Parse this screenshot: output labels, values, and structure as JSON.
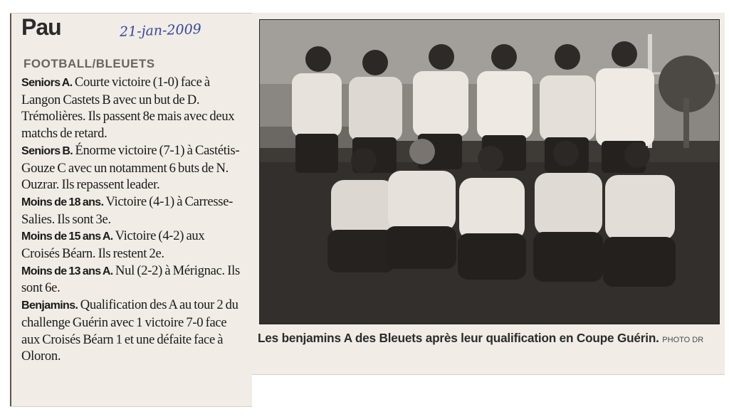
{
  "header": {
    "city": "Pau",
    "date_annotation": "21-jan-2009"
  },
  "article": {
    "section": "FOOTBALL/BLEUETS",
    "items": [
      {
        "lead": "Seniors A.",
        "text": "Courte victoire (1-0) face à Langon Castets B avec un but de D. Trémolières. Ils passent 8e mais avec deux matchs de retard."
      },
      {
        "lead": "Seniors B.",
        "text": "Énorme victoire (7-1) à Castétis-Gouze C avec un notamment 6 buts de N. Ouzrar. Ils repassent leader."
      },
      {
        "lead": "Moins de 18 ans.",
        "text": "Victoire (4-1) à Carresse-Salies. Ils sont 3e."
      },
      {
        "lead": "Moins de 15 ans A.",
        "text": "Victoire (4-2) aux Croisés Béarn. Ils restent 2e."
      },
      {
        "lead": "Moins de 13 ans A.",
        "text": "Nul (2-2) à Mérignac. Ils sont 6e."
      },
      {
        "lead": "Benjamins.",
        "text": "Qualification des A au tour 2 du challenge Guérin avec 1 victoire 7-0 face aux Croisés Béarn 1 et une défaite face à Oloron."
      }
    ]
  },
  "photo": {
    "caption": "Les benjamins A des Bleuets après leur qualification en Coupe Guérin.",
    "credit": "PHOTO DR"
  }
}
